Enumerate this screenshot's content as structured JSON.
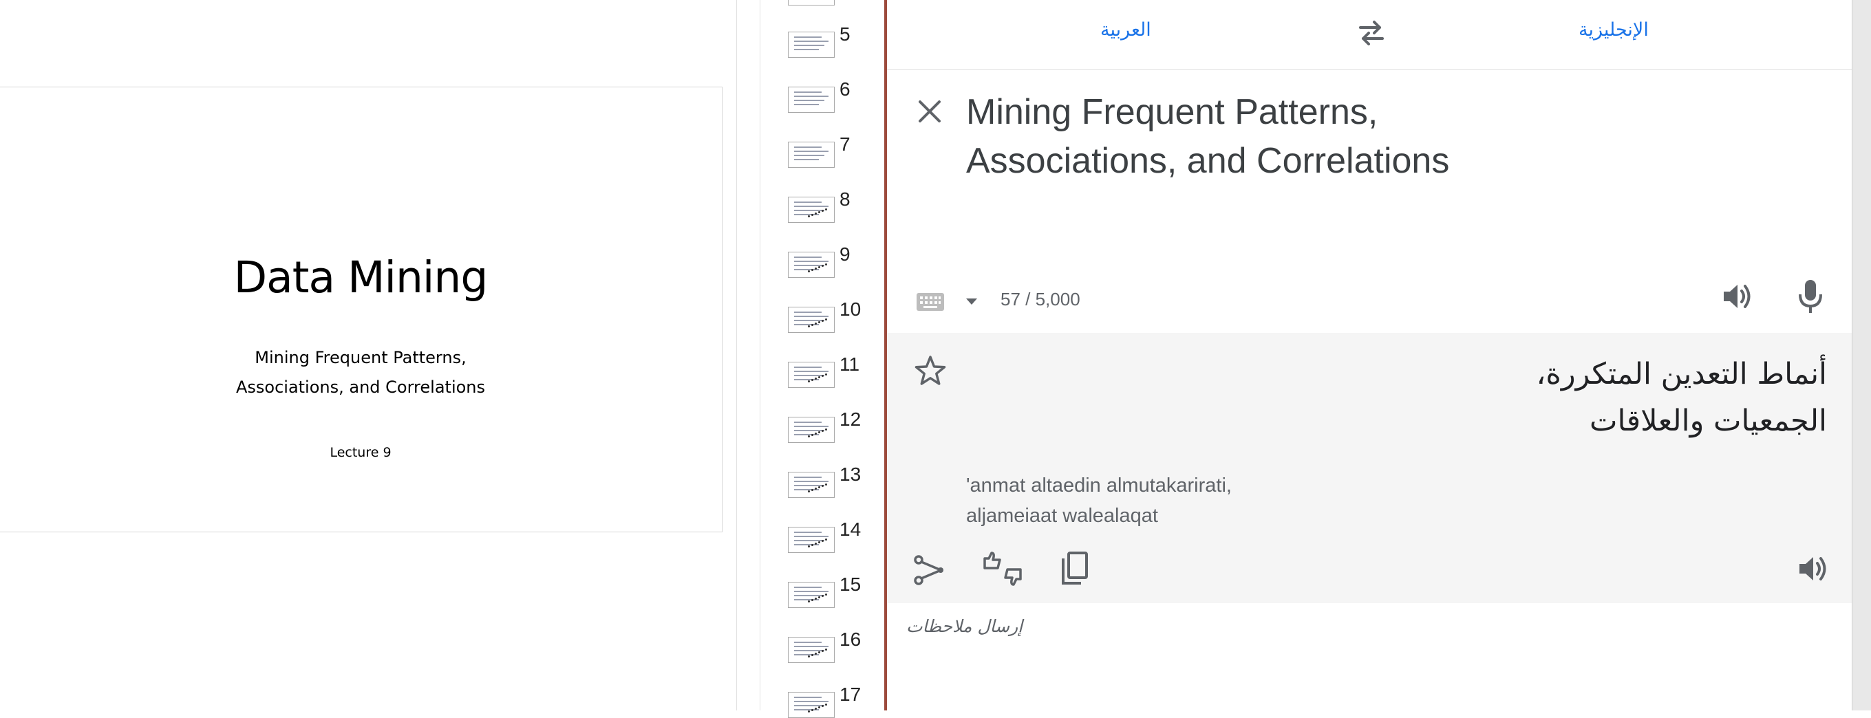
{
  "slide": {
    "title": "Data Mining",
    "subtitle_lines": [
      "Mining Frequent Patterns,",
      "Associations, and Correlations"
    ],
    "footer": "Lecture 9"
  },
  "thumbnails": {
    "numbers": [
      "5",
      "6",
      "7",
      "8",
      "9",
      "10",
      "11",
      "12",
      "13",
      "14",
      "15",
      "16",
      "17"
    ]
  },
  "translate": {
    "source_language": "الإنجليزية",
    "target_language": "العربية",
    "source_lines": [
      "Mining Frequent Patterns,",
      "Associations, and Correlations"
    ],
    "char_count": "57 / 5,000",
    "translation_lines": [
      "أنماط التعدين المتكررة،",
      "الجمعيات والعلاقات"
    ],
    "romanization_lines": [
      "'anmat altaedin almutakarirati,",
      "aljameiaat walealaqat"
    ],
    "feedback_label": "إرسال ملاحظات",
    "icons": [
      "swap-icon",
      "close-icon",
      "keyboard-icon",
      "chevron-down-icon",
      "speaker-icon",
      "microphone-icon",
      "star-icon",
      "share-icon",
      "rate-icon",
      "copy-icon"
    ],
    "colors": {
      "accent": "#1a73e8",
      "output_bg": "#f5f5f5"
    }
  }
}
